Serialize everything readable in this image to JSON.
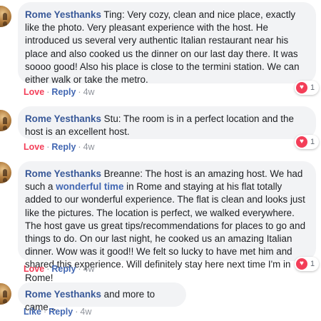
{
  "comments": [
    {
      "author": "Rome Yesthanks",
      "text": "Ting: Very cozy, clean and nice place, exactly like the photo. Very pleasant experience with the host. He introduced us several very authentic Italian restaurant near his place and also cooked us the dinner on our last day there. It was soooo good! Also his place is close to the termini station. We can either walk or take the metro.",
      "reaction_label": "Love",
      "reply_label": "Reply",
      "time": "4w",
      "reaction_count": "1"
    },
    {
      "author": "Rome Yesthanks",
      "text": "Stu: The room is in a perfect location and the host is an excellent host.",
      "reaction_label": "Love",
      "reply_label": "Reply",
      "time": "4w",
      "reaction_count": "1"
    },
    {
      "author": "Rome Yesthanks",
      "text_before": "Breanne: The host is an amazing host. We had such a",
      "link_text": "wonderful time",
      "text_after": "in Rome and staying at his flat totally added to our wonderful experience. The flat is clean and looks just like the pictures. The location is perfect, we walked everywhere. The host gave us great tips/recommendations for places to go and things to do. On our last night, he cooked us an amazing Italian dinner. Wow was it good!! We felt so lucky to have met him and shared this experience. Will definitely stay here next time I'm in Rome!",
      "reaction_label": "Love",
      "reply_label": "Reply",
      "time": "4w",
      "reaction_count": "1"
    },
    {
      "author": "Rome Yesthanks",
      "text": "and more to came...",
      "reaction_label": "Like",
      "reply_label": "Reply",
      "time": "4w"
    }
  ],
  "separator": "·",
  "colors": {
    "author": "#385898",
    "love": "#f33e58",
    "like": "#4267b2",
    "bubble": "#f2f3f5",
    "meta": "#90949c"
  },
  "icons": {
    "reaction_badge": "heart-icon",
    "avatar": "colosseum-avatar"
  }
}
